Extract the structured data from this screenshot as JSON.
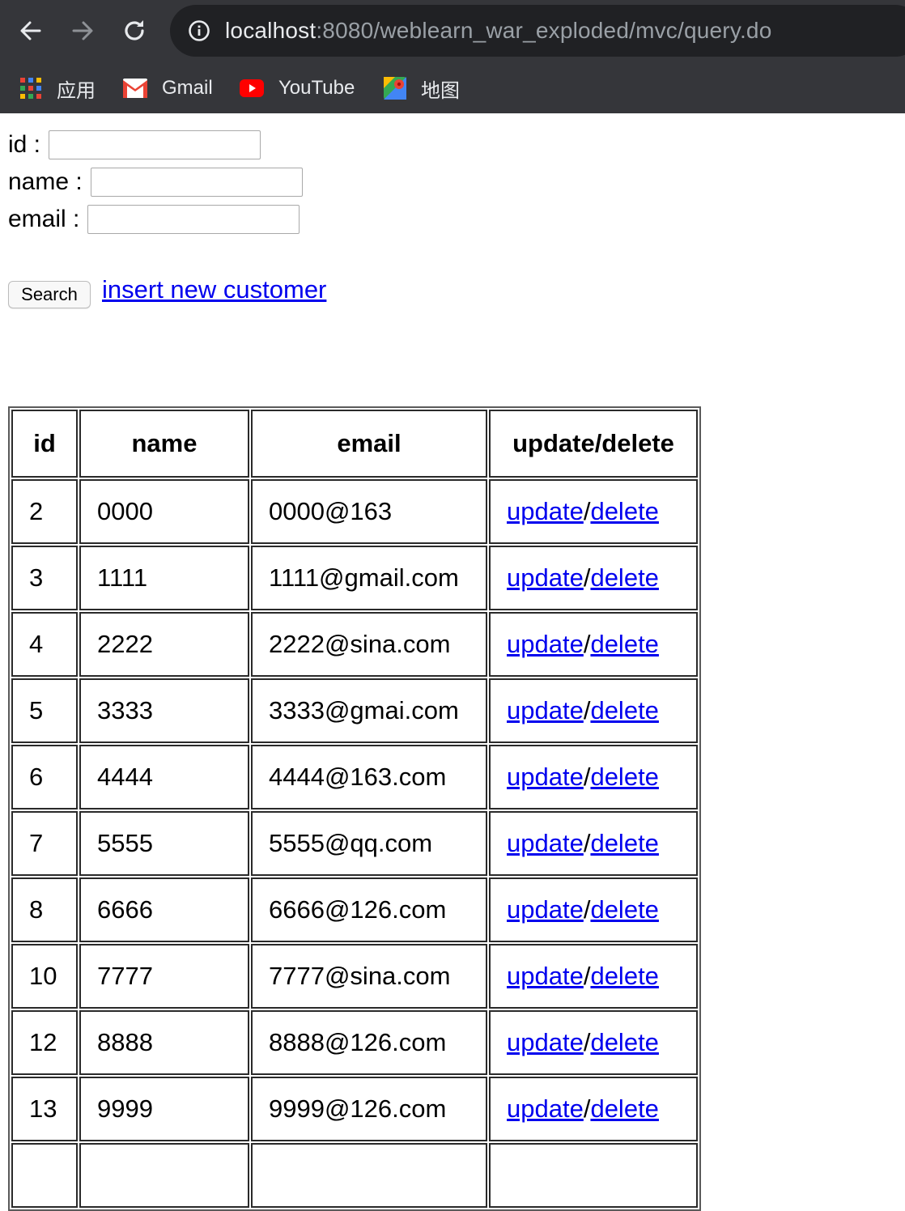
{
  "browser": {
    "url_host": "localhost",
    "url_rest": ":8080/weblearn_war_exploded/mvc/query.do",
    "bookmarks": [
      {
        "label": "应用",
        "icon": "apps-grid-icon"
      },
      {
        "label": "Gmail",
        "icon": "gmail-icon"
      },
      {
        "label": "YouTube",
        "icon": "youtube-icon"
      },
      {
        "label": "地图",
        "icon": "maps-icon"
      }
    ]
  },
  "form": {
    "id_label": "id :",
    "name_label": "name :",
    "email_label": "email :",
    "id_value": "",
    "name_value": "",
    "email_value": "",
    "search_label": "Search",
    "insert_link": "insert new customer"
  },
  "table": {
    "headers": [
      "id",
      "name",
      "email",
      "update/delete"
    ],
    "update_label": "update",
    "delete_label": "delete",
    "separator": "/",
    "rows": [
      {
        "id": "2",
        "name": "0000",
        "email": "0000@163"
      },
      {
        "id": "3",
        "name": "1111",
        "email": "1111@gmail.com"
      },
      {
        "id": "4",
        "name": "2222",
        "email": "2222@sina.com"
      },
      {
        "id": "5",
        "name": "3333",
        "email": "3333@gmai.com"
      },
      {
        "id": "6",
        "name": "4444",
        "email": "4444@163.com"
      },
      {
        "id": "7",
        "name": "5555",
        "email": "5555@qq.com"
      },
      {
        "id": "8",
        "name": "6666",
        "email": "6666@126.com"
      },
      {
        "id": "10",
        "name": "7777",
        "email": "7777@sina.com"
      },
      {
        "id": "12",
        "name": "8888",
        "email": "8888@126.com"
      },
      {
        "id": "13",
        "name": "9999",
        "email": "9999@126.com"
      },
      {
        "id": "",
        "name": "",
        "email": ""
      }
    ]
  }
}
